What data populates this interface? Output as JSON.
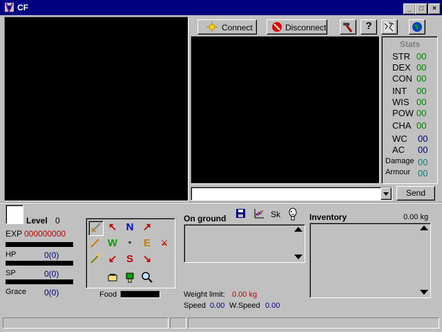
{
  "window": {
    "title": "CF"
  },
  "toolbar": {
    "connect_label": "Connect",
    "disconnect_label": "Disconnect",
    "tools_icon": "hammer-icon",
    "help_icon": "question-icon",
    "map_icon": "map-icon",
    "globe_icon": "globe-icon"
  },
  "stats": {
    "title": "Stats",
    "items": [
      {
        "label": "STR",
        "value": "00"
      },
      {
        "label": "DEX",
        "value": "00"
      },
      {
        "label": "CON",
        "value": "00"
      },
      {
        "label": "INT",
        "value": "00"
      },
      {
        "label": "WIS",
        "value": "00"
      },
      {
        "label": "POW",
        "value": "00"
      },
      {
        "label": "CHA",
        "value": "00"
      }
    ],
    "wc": {
      "label": "WC",
      "value": "00"
    },
    "ac": {
      "label": "AC",
      "value": "00"
    },
    "damage": {
      "label": "Damage",
      "value": "00"
    },
    "armour": {
      "label": "Armour",
      "value": "00"
    }
  },
  "command": {
    "value": "",
    "send_label": "Send"
  },
  "character": {
    "level_label": "Level",
    "level_value": "0",
    "exp_label": "EXP",
    "exp_value": "000000000",
    "hp_label": "HP",
    "hp_value": "0(0)",
    "sp_label": "SP",
    "sp_value": "0(0)",
    "grace_label": "Grace",
    "grace_value": "0(0)",
    "food_label": "Food"
  },
  "ground": {
    "title": "On ground",
    "sk_label": "Sk",
    "weight_limit_label": "Weight limit:",
    "weight_limit_value": "0.00 kg",
    "speed_label": "Speed",
    "speed_value": "0.00",
    "wspeed_label": "W.Speed",
    "wspeed_value": "0.00"
  },
  "inventory": {
    "title": "Inventory",
    "weight": "0.00 kg"
  },
  "spells": {
    "row1": [
      "sword",
      "↖",
      "N",
      "↗"
    ],
    "row2": [
      "wand",
      "W",
      "∘",
      "E",
      "fight"
    ],
    "row3": [
      "rod",
      "↙",
      "S",
      "↘"
    ],
    "row4": [
      "hand",
      "thumb",
      "search"
    ]
  }
}
